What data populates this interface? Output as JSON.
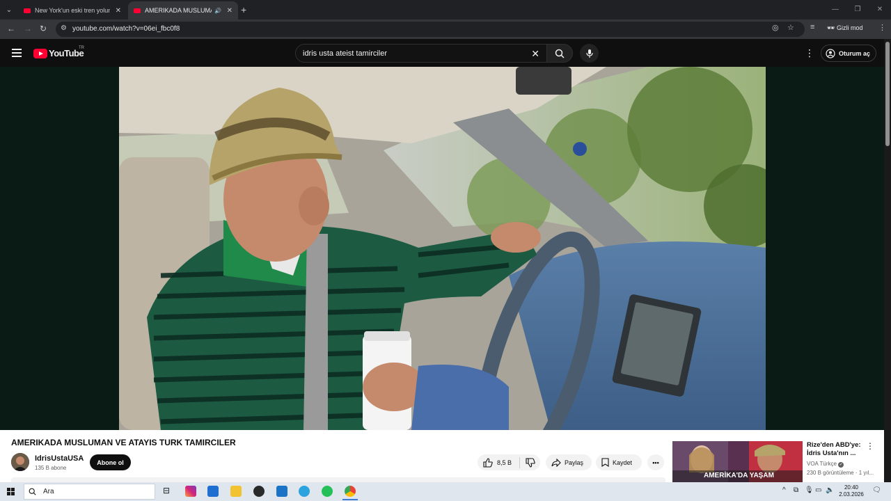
{
  "browser": {
    "tabs": [
      {
        "title": "New York'un eski tren yolunda",
        "active": false
      },
      {
        "title": "AMERIKADA MUSLUMAN V",
        "active": true
      }
    ],
    "url": "youtube.com/watch?v=06ei_fbc0f8",
    "incognito_label": "Gizli mod"
  },
  "youtube": {
    "logo_text": "YouTube",
    "region": "TR",
    "search_query": "idris usta ateist tamirciler",
    "signin_label": "Oturum aç"
  },
  "video": {
    "title": "AMERIKADA MUSLUMAN VE ATAYIS TURK TAMIRCILER",
    "channel": "IdrisUstaUSA",
    "subscribers": "135 B abone",
    "subscribe_label": "Abone ol",
    "likes": "8,5 B",
    "share_label": "Paylaş",
    "save_label": "Kaydet"
  },
  "recommendation": {
    "title": "Rize'den ABD'ye: İdris Usta'nın ...",
    "channel": "VOA Türkçe",
    "meta": "230 B görüntüleme · 1 yıl...",
    "thumb_caption": "AMERİKA'DA YAŞAM"
  },
  "taskbar": {
    "search_label": "Ara",
    "time": "20:40",
    "date": "2.03.2026"
  }
}
